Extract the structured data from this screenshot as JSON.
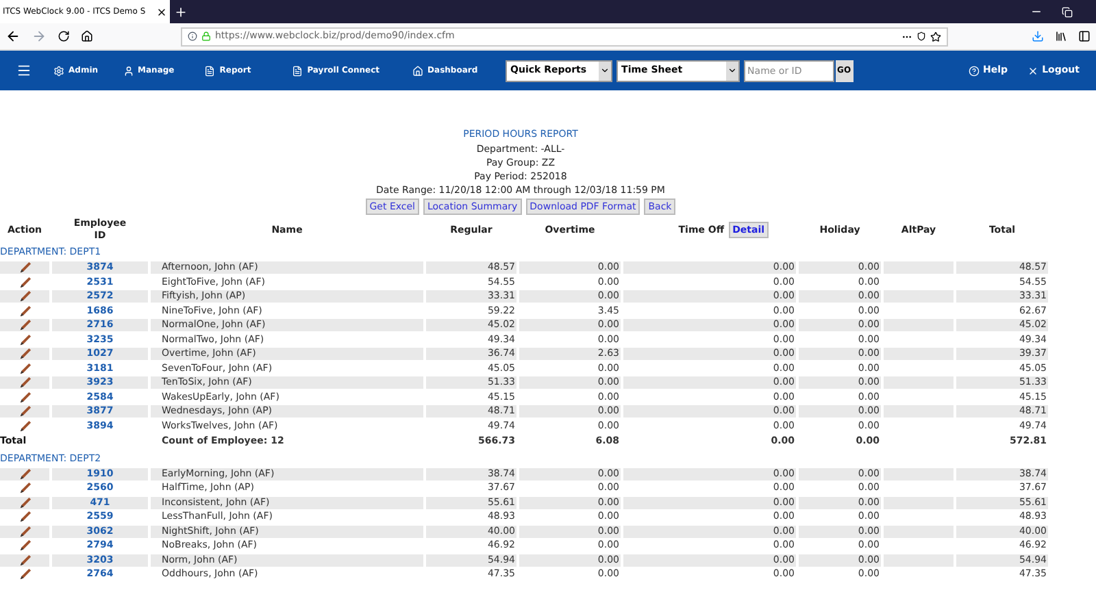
{
  "browser": {
    "tab_title": "ITCS WebClock 9.00 - ITCS Demo S",
    "url": "https://www.webclock.biz/prod/demo90/index.cfm"
  },
  "nav": {
    "items": [
      "Admin",
      "Manage",
      "Report",
      "Payroll Connect",
      "Dashboard"
    ],
    "selects": [
      {
        "value": "Quick Reports"
      },
      {
        "value": "Time Sheet"
      }
    ],
    "search": {
      "placeholder": "Name or ID"
    },
    "go": "GO",
    "right": [
      "Help",
      "Logout"
    ]
  },
  "report": {
    "title": "PERIOD HOURS REPORT",
    "info": [
      "Department: -ALL-",
      "Pay Group: ZZ",
      "Pay Period: 252018",
      "Date Range: 11/20/18 12:00 AM through 12/03/18 11:59 PM"
    ],
    "buttons": [
      "Get Excel",
      "Location Summary",
      "Download PDF Format",
      "Back"
    ],
    "columns": [
      {
        "label": "Action"
      },
      {
        "label": "Employee ID"
      },
      {
        "label": "Name"
      },
      {
        "label": "Regular"
      },
      {
        "label": "Overtime"
      },
      {
        "label": "Time Off",
        "button": "Detail"
      },
      {
        "label": "Holiday"
      },
      {
        "label": "AltPay"
      },
      {
        "label": "Total"
      }
    ],
    "departments": [
      {
        "label": "DEPARTMENT: DEPT1",
        "rows": [
          {
            "id": "3874",
            "name": "Afternoon, John (AF)",
            "regular": "48.57",
            "overtime": "0.00",
            "time_off": "0.00",
            "holiday": "0.00",
            "total": "48.57"
          },
          {
            "id": "2531",
            "name": "EightToFive, John (AF)",
            "regular": "54.55",
            "overtime": "0.00",
            "time_off": "0.00",
            "holiday": "0.00",
            "total": "54.55"
          },
          {
            "id": "2572",
            "name": "Fiftyish, John (AP)",
            "regular": "33.31",
            "overtime": "0.00",
            "time_off": "0.00",
            "holiday": "0.00",
            "total": "33.31"
          },
          {
            "id": "1686",
            "name": "NineToFive, John (AF)",
            "regular": "59.22",
            "overtime": "3.45",
            "time_off": "0.00",
            "holiday": "0.00",
            "total": "62.67"
          },
          {
            "id": "2716",
            "name": "NormalOne, John (AF)",
            "regular": "45.02",
            "overtime": "0.00",
            "time_off": "0.00",
            "holiday": "0.00",
            "total": "45.02"
          },
          {
            "id": "3235",
            "name": "NormalTwo, John (AF)",
            "regular": "49.34",
            "overtime": "0.00",
            "time_off": "0.00",
            "holiday": "0.00",
            "total": "49.34"
          },
          {
            "id": "1027",
            "name": "Overtime, John (AF)",
            "regular": "36.74",
            "overtime": "2.63",
            "time_off": "0.00",
            "holiday": "0.00",
            "total": "39.37"
          },
          {
            "id": "3181",
            "name": "SevenToFour, John (AF)",
            "regular": "45.05",
            "overtime": "0.00",
            "time_off": "0.00",
            "holiday": "0.00",
            "total": "45.05"
          },
          {
            "id": "3923",
            "name": "TenToSix, John (AF)",
            "regular": "51.33",
            "overtime": "0.00",
            "time_off": "0.00",
            "holiday": "0.00",
            "total": "51.33"
          },
          {
            "id": "2584",
            "name": "WakesUpEarly, John (AF)",
            "regular": "45.15",
            "overtime": "0.00",
            "time_off": "0.00",
            "holiday": "0.00",
            "total": "45.15"
          },
          {
            "id": "3877",
            "name": "Wednesdays, John (AP)",
            "regular": "48.71",
            "overtime": "0.00",
            "time_off": "0.00",
            "holiday": "0.00",
            "total": "48.71"
          },
          {
            "id": "3894",
            "name": "WorksTwelves, John (AF)",
            "regular": "49.74",
            "overtime": "0.00",
            "time_off": "0.00",
            "holiday": "0.00",
            "total": "49.74"
          }
        ],
        "total": {
          "label": "Total",
          "count": "Count of Employee: 12",
          "regular": "566.73",
          "overtime": "6.08",
          "time_off": "0.00",
          "holiday": "0.00",
          "total": "572.81"
        }
      },
      {
        "label": "DEPARTMENT: DEPT2",
        "rows": [
          {
            "id": "1910",
            "name": "EarlyMorning, John (AF)",
            "regular": "38.74",
            "overtime": "0.00",
            "time_off": "0.00",
            "holiday": "0.00",
            "total": "38.74"
          },
          {
            "id": "2560",
            "name": "HalfTime, John (AP)",
            "regular": "37.67",
            "overtime": "0.00",
            "time_off": "0.00",
            "holiday": "0.00",
            "total": "37.67"
          },
          {
            "id": "471",
            "name": "Inconsistent, John (AF)",
            "regular": "55.61",
            "overtime": "0.00",
            "time_off": "0.00",
            "holiday": "0.00",
            "total": "55.61"
          },
          {
            "id": "2559",
            "name": "LessThanFull, John (AF)",
            "regular": "48.93",
            "overtime": "0.00",
            "time_off": "0.00",
            "holiday": "0.00",
            "total": "48.93"
          },
          {
            "id": "3062",
            "name": "NightShift, John (AF)",
            "regular": "40.00",
            "overtime": "0.00",
            "time_off": "0.00",
            "holiday": "0.00",
            "total": "40.00"
          },
          {
            "id": "2794",
            "name": "NoBreaks, John (AF)",
            "regular": "46.92",
            "overtime": "0.00",
            "time_off": "0.00",
            "holiday": "0.00",
            "total": "46.92"
          },
          {
            "id": "3203",
            "name": "Norm, John (AF)",
            "regular": "54.94",
            "overtime": "0.00",
            "time_off": "0.00",
            "holiday": "0.00",
            "total": "54.94"
          },
          {
            "id": "2764",
            "name": "Oddhours, John (AF)",
            "regular": "47.35",
            "overtime": "0.00",
            "time_off": "0.00",
            "holiday": "0.00",
            "total": "47.35"
          }
        ]
      }
    ]
  }
}
